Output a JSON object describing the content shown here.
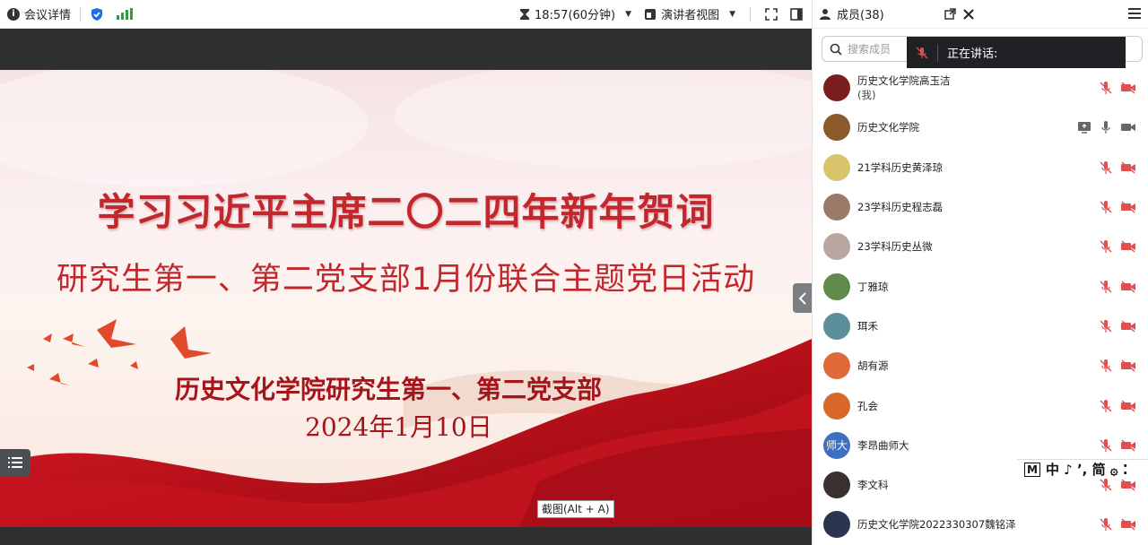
{
  "topbar": {
    "meeting_details": "会议详情",
    "timer": "18:57(60分钟)",
    "view_mode": "演讲者视图"
  },
  "slide": {
    "title": "学习习近平主席二〇二四年新年贺词",
    "subtitle": "研究生第一、第二党支部1月份联合主题党日活动",
    "organizer": "历史文化学院研究生第一、第二党支部",
    "date": "2024年1月10日"
  },
  "screenshot_tip": "截图(Alt + A)",
  "panel": {
    "title": "成员(38)",
    "search_placeholder": "搜索成员",
    "speaking_label": "正在讲话:"
  },
  "members": [
    {
      "name": "历史文化学院高玉洁",
      "suffix": "(我)",
      "avatar_color": "#7a1f1f",
      "mic_muted": true,
      "cam_off": true,
      "screen": false
    },
    {
      "name": "历史文化学院",
      "suffix": "",
      "avatar_color": "#8a5a2b",
      "mic_muted": false,
      "cam_off": false,
      "screen": true
    },
    {
      "name": "21学科历史黄泽琼",
      "suffix": "",
      "avatar_color": "#d8c46a",
      "mic_muted": true,
      "cam_off": true,
      "screen": false
    },
    {
      "name": "23学科历史程志磊",
      "suffix": "",
      "avatar_color": "#9a7b6a",
      "mic_muted": true,
      "cam_off": true,
      "screen": false
    },
    {
      "name": "23学科历史丛微",
      "suffix": "",
      "avatar_color": "#b9a6a0",
      "mic_muted": true,
      "cam_off": true,
      "screen": false
    },
    {
      "name": "丁雅琼",
      "suffix": "",
      "avatar_color": "#5f8a4a",
      "mic_muted": true,
      "cam_off": true,
      "screen": false
    },
    {
      "name": "珥禾",
      "suffix": "",
      "avatar_color": "#5b8f9a",
      "mic_muted": true,
      "cam_off": true,
      "screen": false
    },
    {
      "name": "胡有源",
      "suffix": "",
      "avatar_color": "#e06a3a",
      "mic_muted": true,
      "cam_off": true,
      "screen": false
    },
    {
      "name": "孔会",
      "suffix": "",
      "avatar_color": "#d9662a",
      "mic_muted": true,
      "cam_off": true,
      "screen": false
    },
    {
      "name": "李昂曲师大",
      "suffix": "",
      "avatar_color": "#3f6fbf",
      "avatar_text": "师大",
      "mic_muted": true,
      "cam_off": true,
      "screen": false
    },
    {
      "name": "李文科",
      "suffix": "",
      "avatar_color": "#3a3030",
      "mic_muted": true,
      "cam_off": true,
      "screen": false
    },
    {
      "name": "历史文化学院2022330307魏铭泽",
      "suffix": "",
      "avatar_color": "#2b3550",
      "mic_muted": true,
      "cam_off": true,
      "screen": false
    }
  ],
  "ime": {
    "mode": "M",
    "chars": "中 ♪ ʼ, 简 ۞ ⁚"
  },
  "colors": {
    "accent_red": "#c1272d",
    "mute_red": "#e05050",
    "signal_green": "#2ea043",
    "shield_blue": "#1a6fe8"
  }
}
